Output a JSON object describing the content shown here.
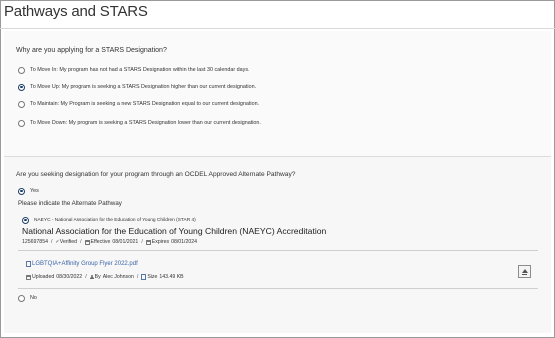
{
  "page": {
    "title": "Pathways and STARS"
  },
  "section1": {
    "question": "Why are you applying for a STARS Designation?",
    "options": [
      {
        "label": "To Move In: My program has not had a STARS Designation within the last 30 calendar days.",
        "selected": false
      },
      {
        "label": "To Move Up: My program is seeking a STARS Designation higher than our current designation.",
        "selected": true
      },
      {
        "label": "To Maintain: My Program is seeking a new STARS Designation equal to our current designation.",
        "selected": false
      },
      {
        "label": "To Move Down: My program is seeking a STARS Designation lower than our current designation.",
        "selected": false
      }
    ]
  },
  "section2": {
    "question": "Are you seeking designation for your program through an OCDEL Approved Alternate Pathway?",
    "yes_label": "Yes",
    "no_label": "No",
    "yes_selected": true,
    "pathway_prompt": "Please indicate the Alternate Pathway",
    "pathway": {
      "short_label": "NAEYC - National Association for the Education of Young Children (STAR 4)",
      "full_name": "National Association for the Education of Young Children (NAEYC) Accreditation",
      "id": "125697854",
      "verified": "✓Verified",
      "effective_label": "Effective",
      "effective_date": "08/01/2021",
      "expires_label": "Expires",
      "expires_date": "08/01/2024",
      "file_name": "LGBTQIA+Affinity Group Flyer 2022.pdf",
      "uploaded_label": "Uploaded",
      "uploaded_date": "08/30/2022",
      "by_label": "By",
      "uploader": "Alec Johnson",
      "size_label": "Size",
      "size_value": "143.49 KB"
    }
  },
  "icons": {
    "calendar": "calendar-icon",
    "document": "document-icon",
    "user": "user-icon",
    "upload": "upload-icon"
  },
  "colors": {
    "accent": "#1f3f66",
    "link": "#3a64a8"
  }
}
